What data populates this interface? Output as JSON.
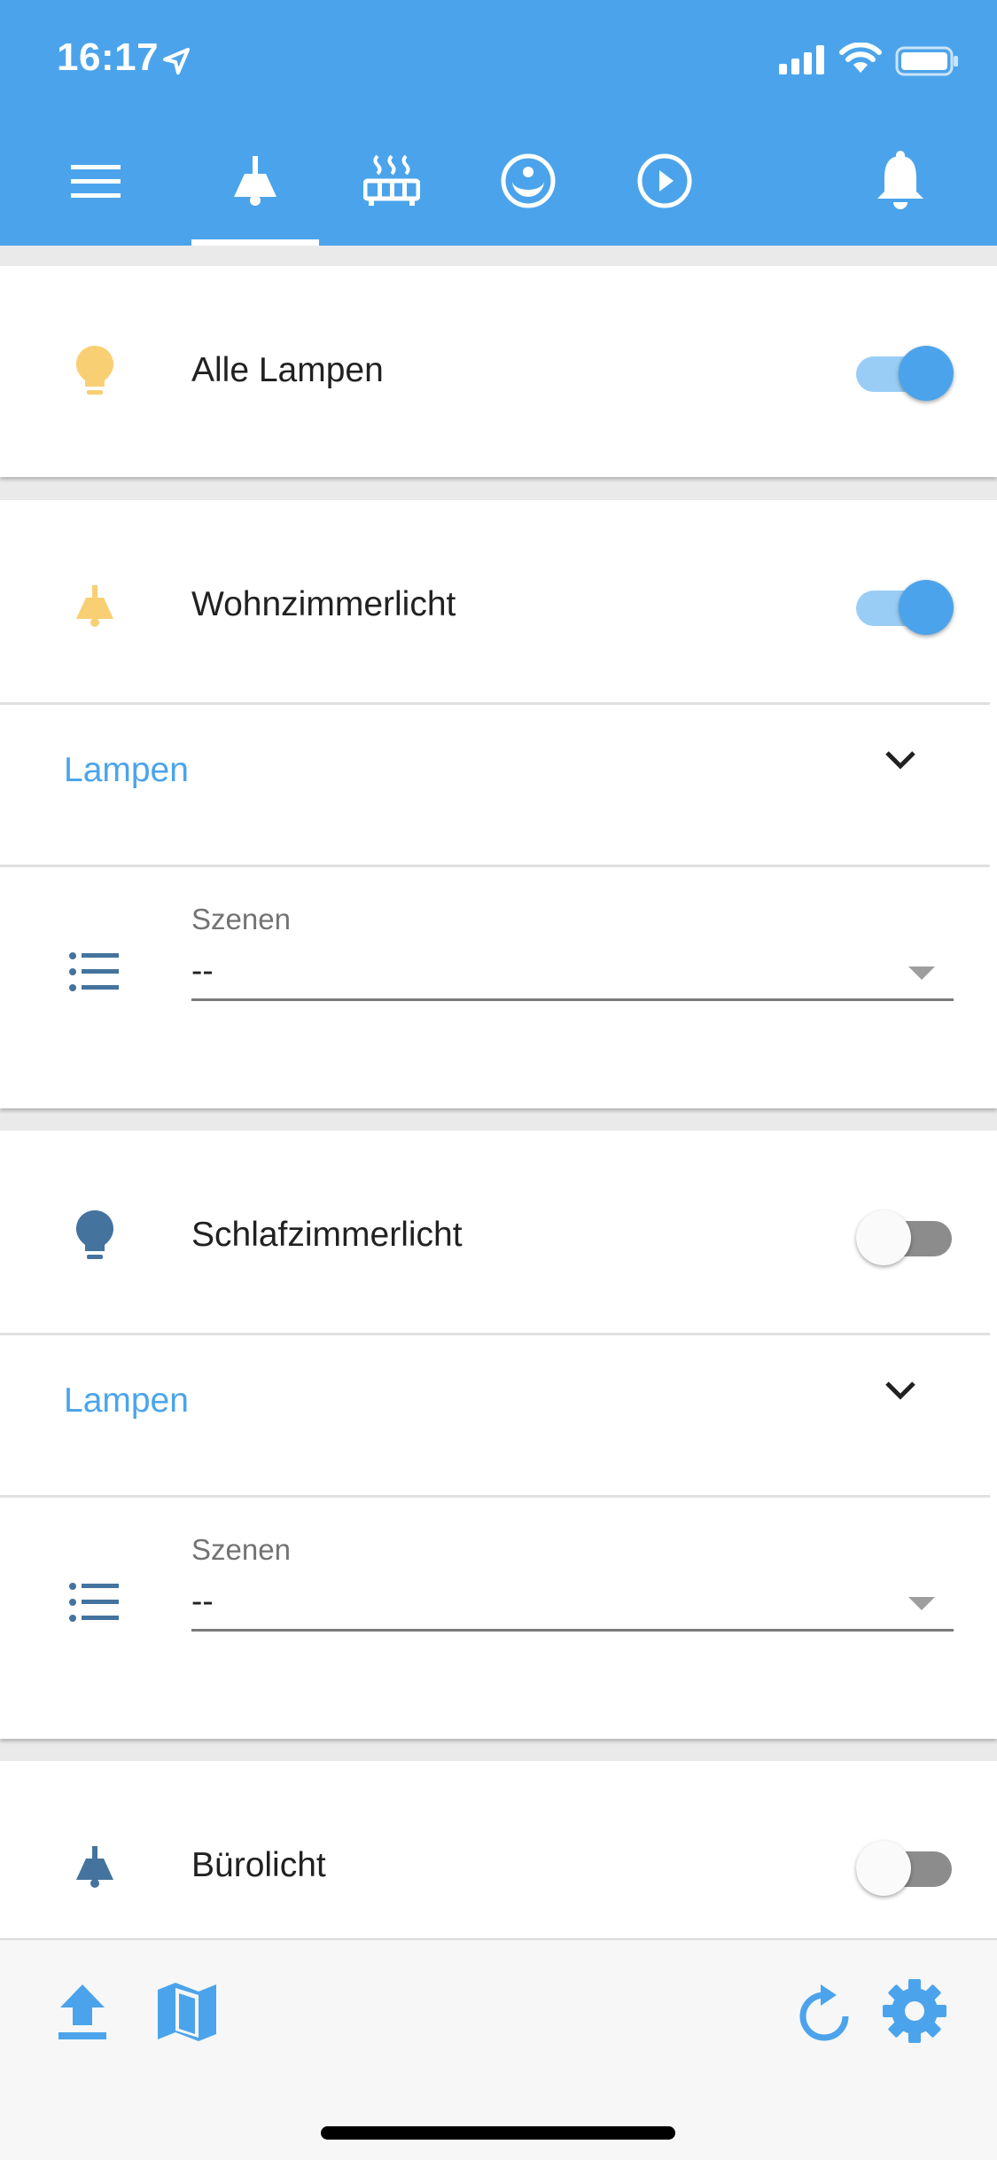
{
  "status_bar": {
    "time": "16:17"
  },
  "tabs": [
    {
      "name": "lights",
      "icon": "ceiling-lamp-icon",
      "active": true
    },
    {
      "name": "heating",
      "icon": "radiator-icon",
      "active": false
    },
    {
      "name": "vacuum",
      "icon": "robot-vacuum-icon",
      "active": false
    },
    {
      "name": "media",
      "icon": "play-circle-icon",
      "active": false
    }
  ],
  "header_icons": {
    "menu": "menu-icon",
    "notifications": "bell-icon"
  },
  "cards": {
    "all_lamps": {
      "label": "Alle Lampen",
      "icon": "lightbulb-icon",
      "icon_color": "#f9cf74",
      "state": "on"
    },
    "living_room": {
      "label": "Wohnzimmerlicht",
      "icon": "ceiling-lamp-icon",
      "icon_color": "#f9cf74",
      "state": "on",
      "section_label": "Lampen",
      "scenes_label": "Szenen",
      "scenes_value": "--"
    },
    "bedroom": {
      "label": "Schlafzimmerlicht",
      "icon": "lightbulb-icon",
      "icon_color": "#44739e",
      "state": "off",
      "section_label": "Lampen",
      "scenes_label": "Szenen",
      "scenes_value": "--"
    },
    "office": {
      "label": "Bürolicht",
      "icon": "ceiling-lamp-icon",
      "icon_color": "#44739e",
      "state": "off"
    }
  },
  "bottom_bar": {
    "upload": "upload-icon",
    "map": "map-icon",
    "refresh": "refresh-icon",
    "settings": "gear-icon"
  },
  "colors": {
    "primary": "#4ba4eb",
    "toggle_on_track": "#99cdf5",
    "toggle_off_track": "#8c8c8c",
    "lamp_on": "#f9cf74",
    "lamp_off": "#44739e"
  }
}
